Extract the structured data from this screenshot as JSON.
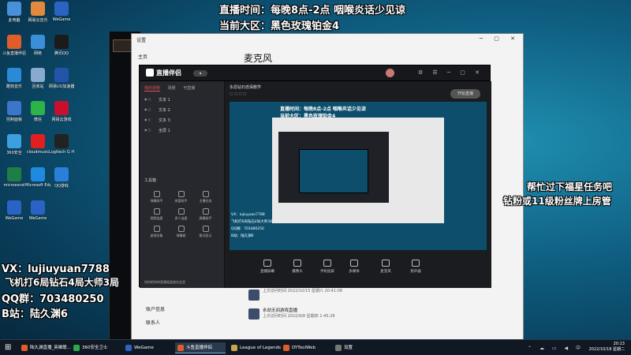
{
  "overlay": {
    "top_line1": "直播时间：每晚8点-2点   咽喉炎话少见谅",
    "top_line2": "当前大区：黑色玫瑰铂金4",
    "right_line1": "帮忙过下福星任务吧",
    "right_line2": "钻粉或11级粉丝牌上房管",
    "left_line1": "VX：lujiuyuan7788",
    "left_line2": "飞机打6局钻石4局大师3局",
    "left_line3": "QQ群：703480250",
    "left_line4": "B站：陆久渊6"
  },
  "desktop_icons": [
    {
      "label": "此电脑",
      "color": "#4a90d9"
    },
    {
      "label": "网易云音乐",
      "color": "#e1893c"
    },
    {
      "label": "WeGame",
      "color": "#2b63c4"
    },
    {
      "label": "斗鱼直播伴侣",
      "color": "#e05d2a"
    },
    {
      "label": "网络",
      "color": "#3a8fd8"
    },
    {
      "label": "腾讯QQ",
      "color": "#1b1b1b"
    },
    {
      "label": "酷狗音乐",
      "color": "#2a8ad6"
    },
    {
      "label": "回收站",
      "color": "#88aacc"
    },
    {
      "label": "网易UU加速器",
      "color": "#2255aa"
    },
    {
      "label": "控制面板",
      "color": "#3b76c9"
    },
    {
      "label": "微信",
      "color": "#2cb34a"
    },
    {
      "label": "网易云游戏",
      "color": "#c8102e"
    },
    {
      "label": "360安全",
      "color": "#3aa0e0"
    },
    {
      "label": "cloudmusic",
      "color": "#e02020"
    },
    {
      "label": "Logitech G HUB",
      "color": "#222222"
    },
    {
      "label": "microexcel",
      "color": "#1e7e45"
    },
    {
      "label": "Microsoft Edge",
      "color": "#1f8be0"
    },
    {
      "label": "QQ游戏",
      "color": "#2a7fd8"
    },
    {
      "label": "WeGame",
      "color": "#2b63c4"
    },
    {
      "label": "WeGame",
      "color": "#2b63c4"
    }
  ],
  "settings_window": {
    "title": "设置",
    "heading": "麦克风",
    "nav": [
      "主页"
    ],
    "bottom_nav": [
      "账户信息",
      "联系人"
    ],
    "list": [
      {
        "name": "",
        "time": "上次访问时间 2022/10/15 星期六 20:41:08"
      },
      {
        "name": "永劫无间游戏直播",
        "time": "上次访问时间 2022/9/8 星期四 1:45:28"
      }
    ]
  },
  "app": {
    "brand": "直播伴侣",
    "room_title": "永恩钻石低保教学 ",
    "tabs": [
      "我的场景",
      "场景",
      "可直播"
    ],
    "scenes": [
      "文本 1",
      "文本 2",
      "文本 3",
      "全屏 1"
    ],
    "tools_label": "工具箱",
    "tools": [
      "弹幕助手",
      "房管助手",
      "主播任务",
      "视频连麦",
      "多人连麦",
      "屏幕助手",
      "虚拟形象",
      "弹幕姬",
      "歌词显示"
    ],
    "bottom_link": "如何把你的直播画面放在这里",
    "controls": [
      "直播屏幕",
      "摄像头",
      "手机投屏",
      "多媒体",
      "麦克风",
      "扬声器"
    ],
    "start_button": "开始直播",
    "preview_line1": "直播时间：每晚8点-2点   咽喉炎话少见谅",
    "preview_line2": "当前大区：黑色玫瑰铂金4",
    "preview_vx": "VX：lujiuyuan7788",
    "preview_game": "飞机打6局钻石4局大师3局",
    "preview_qq": "QQ群：703480250",
    "preview_bz": "B站：陆久渊6"
  },
  "taskbar": {
    "items": [
      {
        "label": "陆久渊直播_英雄联...",
        "color": "#e05d2a"
      },
      {
        "label": "360安全卫士",
        "color": "#2ea84a"
      },
      {
        "label": "WeGame",
        "color": "#2b63c4"
      },
      {
        "label": "斗鱼直播伴侣",
        "color": "#e05d2a"
      },
      {
        "label": "League of Legends",
        "color": "#c9a54a"
      },
      {
        "label": "DYToolWeb",
        "color": "#e05d2a"
      },
      {
        "label": "设置",
        "color": "#777777"
      }
    ],
    "time": "20:13",
    "date": "2022/10/18 星期二"
  }
}
